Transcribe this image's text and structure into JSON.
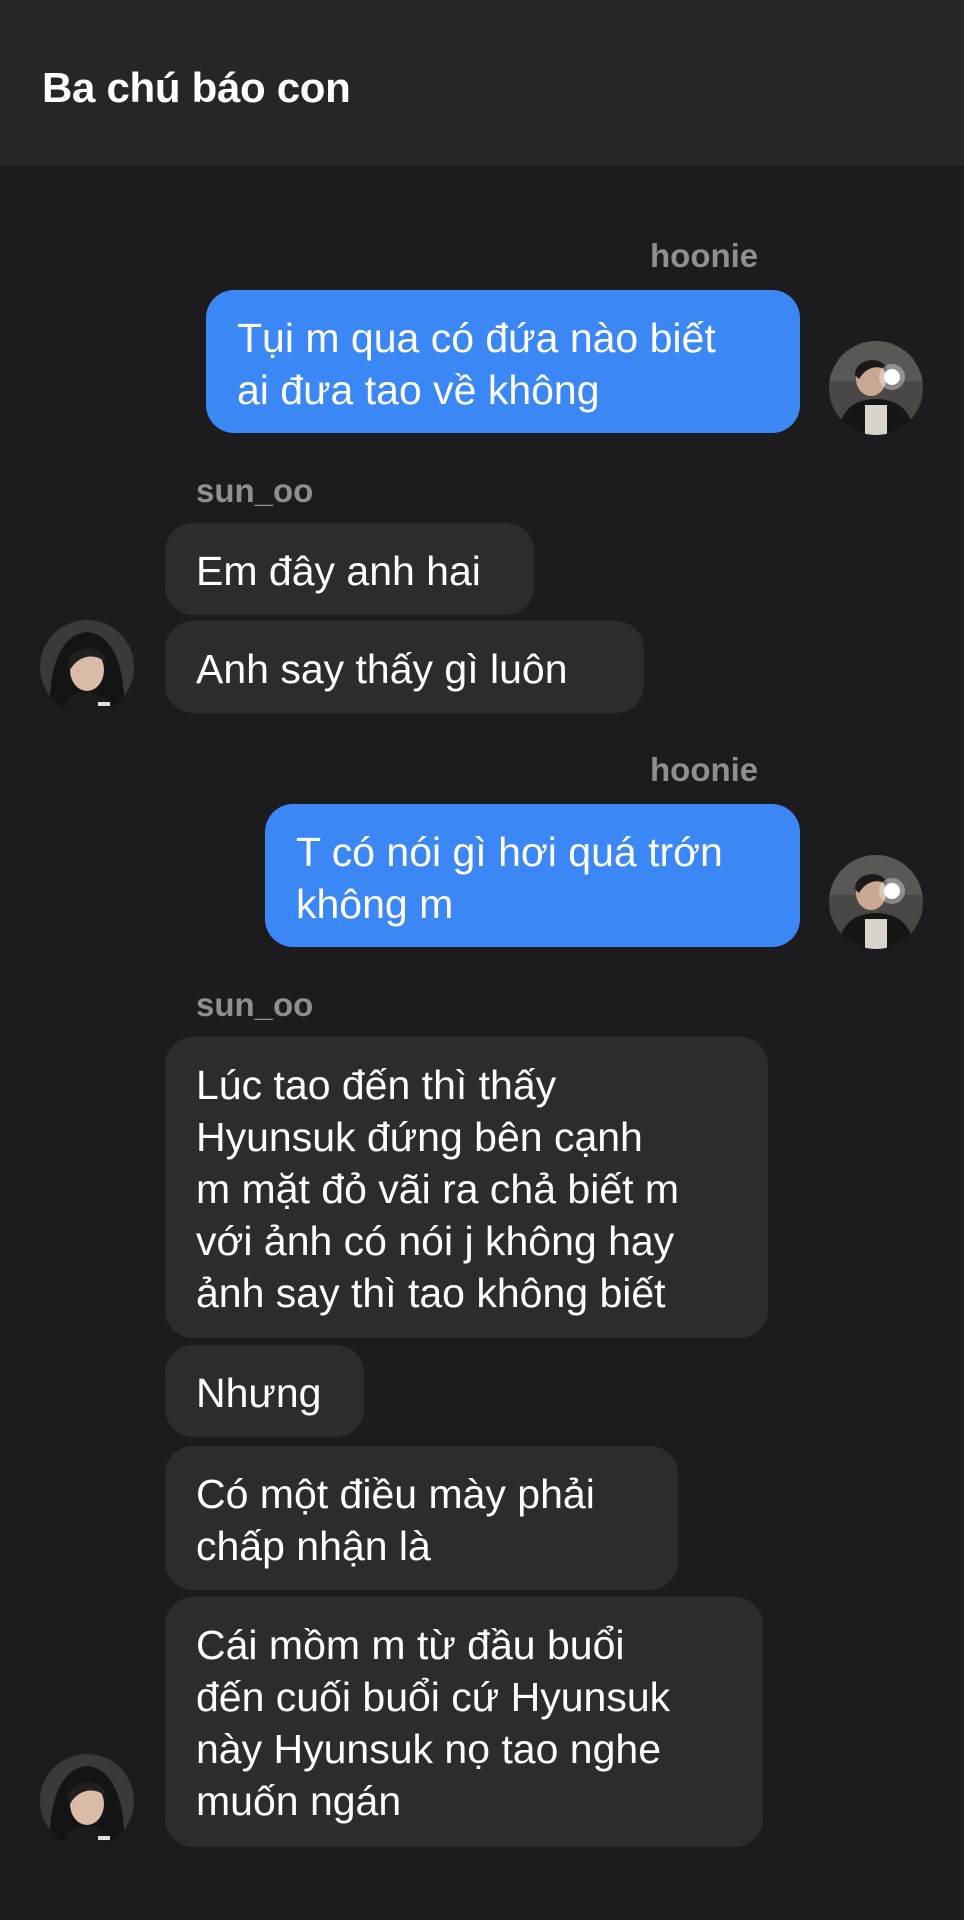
{
  "header": {
    "title": "Ba chú báo con"
  },
  "messages": [
    {
      "sender": "hoonie",
      "direction": "outgoing",
      "lines": [
        "Tụi m qua có đứa nào biết",
        "ai đưa tao về không"
      ]
    },
    {
      "sender": "sun_oo",
      "direction": "incoming",
      "lines": [
        "Em đây anh hai"
      ]
    },
    {
      "sender": "sun_oo",
      "direction": "incoming",
      "lines": [
        "Anh say thấy gì luôn"
      ]
    },
    {
      "sender": "hoonie",
      "direction": "outgoing",
      "lines": [
        "T có nói gì hơi quá trớn",
        "không m"
      ]
    },
    {
      "sender": "sun_oo",
      "direction": "incoming",
      "lines": [
        "Lúc tao đến thì thấy",
        "Hyunsuk đứng bên cạnh",
        "m mặt đỏ vãi ra chả biết m",
        "với ảnh có nói j không hay",
        "ảnh say thì tao không biết"
      ]
    },
    {
      "sender": "sun_oo",
      "direction": "incoming",
      "lines": [
        "Nhưng"
      ]
    },
    {
      "sender": "sun_oo",
      "direction": "incoming",
      "lines": [
        "Có một điều mày phải",
        "chấp nhận là"
      ]
    },
    {
      "sender": "sun_oo",
      "direction": "incoming",
      "lines": [
        "Cái mồm m từ đầu buổi",
        "đến cuối buổi cứ Hyunsuk",
        "này Hyunsuk nọ tao nghe",
        "muốn ngán"
      ]
    }
  ],
  "colors": {
    "background": "#1c1c1e",
    "header": "#262628",
    "outgoing_bubble": "#3b87f5",
    "incoming_bubble": "#2c2c2e",
    "sender_label": "#8e8e93"
  }
}
